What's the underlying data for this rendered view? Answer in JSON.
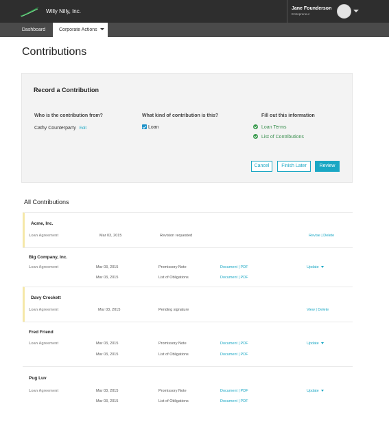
{
  "header": {
    "company": "Willy Nilly, Inc.",
    "user_name": "Jane Founderson",
    "user_role": "Entrepreneur",
    "accent": "#1aa7c4"
  },
  "nav": {
    "dashboard": "Dashboard",
    "corporate_actions": "Corporate Actions"
  },
  "page": {
    "title": "Contributions"
  },
  "record": {
    "title": "Record a Contribution",
    "q_from": "Who is the contribution from?",
    "q_kind": "What kind of contribution is this?",
    "q_fill": "Fill out this information",
    "from_name": "Cathy Counterparty",
    "edit_label": "Edit",
    "kind_value": "Loan",
    "fill_items": [
      "Loan Terms",
      "List of Contributions"
    ],
    "cancel_label": "Cancel",
    "finish_later_label": "Finish Later",
    "review_label": "Review"
  },
  "all": {
    "title": "All Contributions",
    "rows": [
      {
        "name": "Acme, Inc.",
        "type": "Loan Agreement",
        "date": "Mar 03, 2015",
        "status": "Revision requested",
        "actions": "Revise | Delete"
      },
      {
        "name": "Big Company, Inc.",
        "type": "Loan Agreement",
        "lines": [
          {
            "date": "Mar 03, 2015",
            "doc": "Promissory Note",
            "links": "Document | PDF"
          },
          {
            "date": "Mar 03, 2015",
            "doc": "List of Obligations",
            "links": "Document | PDF"
          }
        ],
        "actions": "Update"
      },
      {
        "name": "Davy Crockett",
        "type": "Loan Agreement",
        "date": "Mar 03, 2015",
        "status": "Pending signature",
        "actions": "View | Delete"
      },
      {
        "name": "Fred Friend",
        "type": "Loan Agreement",
        "lines": [
          {
            "date": "Mar 03, 2015",
            "doc": "Promissory Note",
            "links": "Document | PDF"
          },
          {
            "date": "Mar 03, 2015",
            "doc": "List of Obligations",
            "links": "Document | PDF"
          }
        ],
        "actions": "Update"
      },
      {
        "name": "Pug Luv",
        "type": "Loan Agreement",
        "lines": [
          {
            "date": "Mar 03, 2015",
            "doc": "Promissory Note",
            "links": "Document | PDF"
          },
          {
            "date": "Mar 03, 2015",
            "doc": "List of Obligations",
            "links": "Document | PDF"
          }
        ],
        "actions": "Update"
      }
    ]
  }
}
